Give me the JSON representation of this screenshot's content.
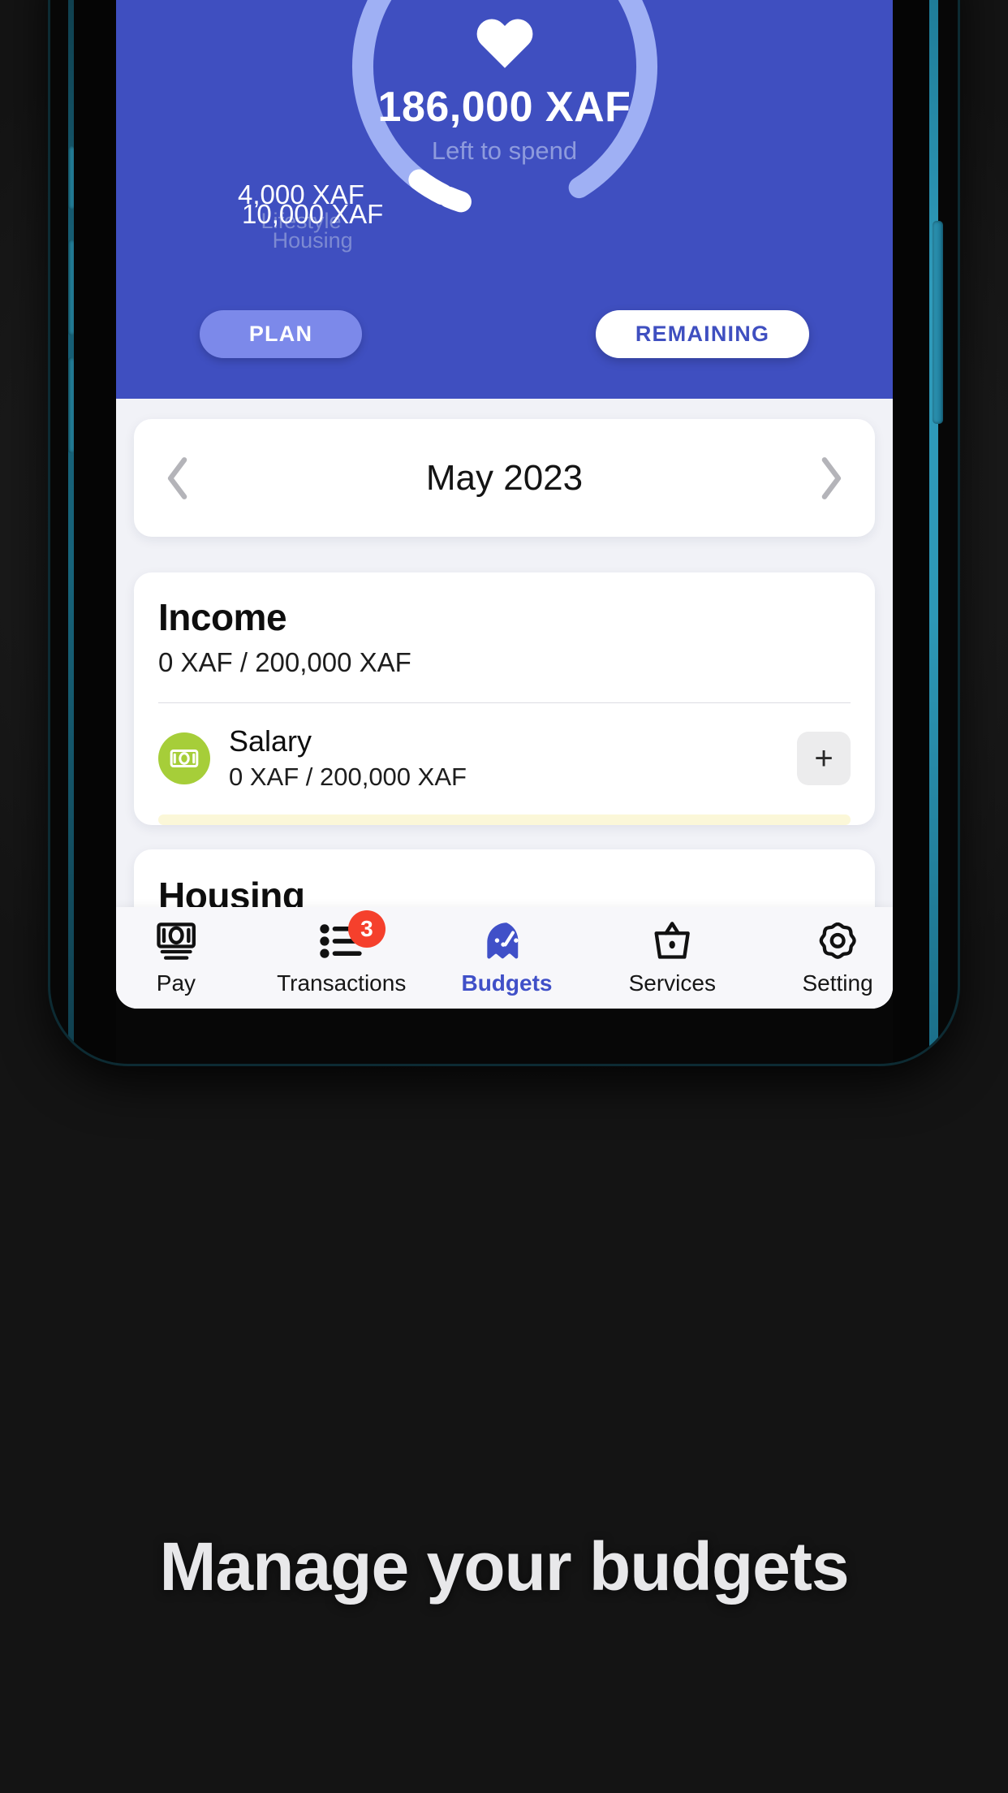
{
  "caption": "Manage your budgets",
  "hero": {
    "amount": "186,000 XAF",
    "amount_caption": "Left to spend",
    "heart_icon": "heart-icon",
    "slices": [
      {
        "amount": "4,000 XAF",
        "category": "Lifestyle"
      },
      {
        "amount": "10,000 XAF",
        "category": "Housing"
      }
    ],
    "tabs": {
      "plan": "PLAN",
      "remaining": "REMAINING"
    },
    "colors": {
      "background": "#3f4fc0",
      "arc_track": "#9fb0f4",
      "marker": "#ffffff",
      "caption_text": "#8e9bdd",
      "tab_active_bg": "#7c89ea",
      "tab_inactive_bg": "#ffffff",
      "tab_inactive_text": "#3f4fc0"
    }
  },
  "month_selector": {
    "prev_icon": "chevron-left-icon",
    "next_icon": "chevron-right-icon",
    "label": "May 2023"
  },
  "income_card": {
    "title": "Income",
    "subtitle": "0 XAF / 200,000 XAF",
    "rows": [
      {
        "icon": "banknote-icon",
        "icon_color": "#a6ce39",
        "name": "Salary",
        "sub": "0 XAF / 200,000 XAF",
        "add_label": "+",
        "progress_percent": 0,
        "progress_track_color": "#fbf7d8",
        "progress_fill_color": "#eede4a"
      }
    ]
  },
  "housing_card": {
    "title": "Housing"
  },
  "bottom_nav": {
    "items": [
      {
        "id": "pay",
        "label": "Pay",
        "icon": "banknote-icon",
        "active": false,
        "badge": ""
      },
      {
        "id": "transactions",
        "label": "Transactions",
        "icon": "list-icon",
        "active": false,
        "badge": "3"
      },
      {
        "id": "budgets",
        "label": "Budgets",
        "icon": "speedometer-icon",
        "active": true,
        "badge": ""
      },
      {
        "id": "services",
        "label": "Services",
        "icon": "basket-icon",
        "active": false,
        "badge": ""
      },
      {
        "id": "settings",
        "label": "Setting",
        "icon": "gear-icon",
        "active": false,
        "badge": ""
      }
    ],
    "active_color": "#4050c8",
    "badge_color": "#f5402c"
  },
  "chart_data": {
    "type": "pie",
    "title": "Left to spend",
    "center_value": "186,000 XAF",
    "categories": [
      "Lifestyle",
      "Housing",
      "Remaining"
    ],
    "values": [
      4000,
      10000,
      186000
    ],
    "value_labels": [
      "4,000 XAF",
      "10,000 XAF",
      "186,000 XAF"
    ],
    "total": 200000,
    "unit": "XAF",
    "grid": false,
    "legend": "inline-labels"
  }
}
